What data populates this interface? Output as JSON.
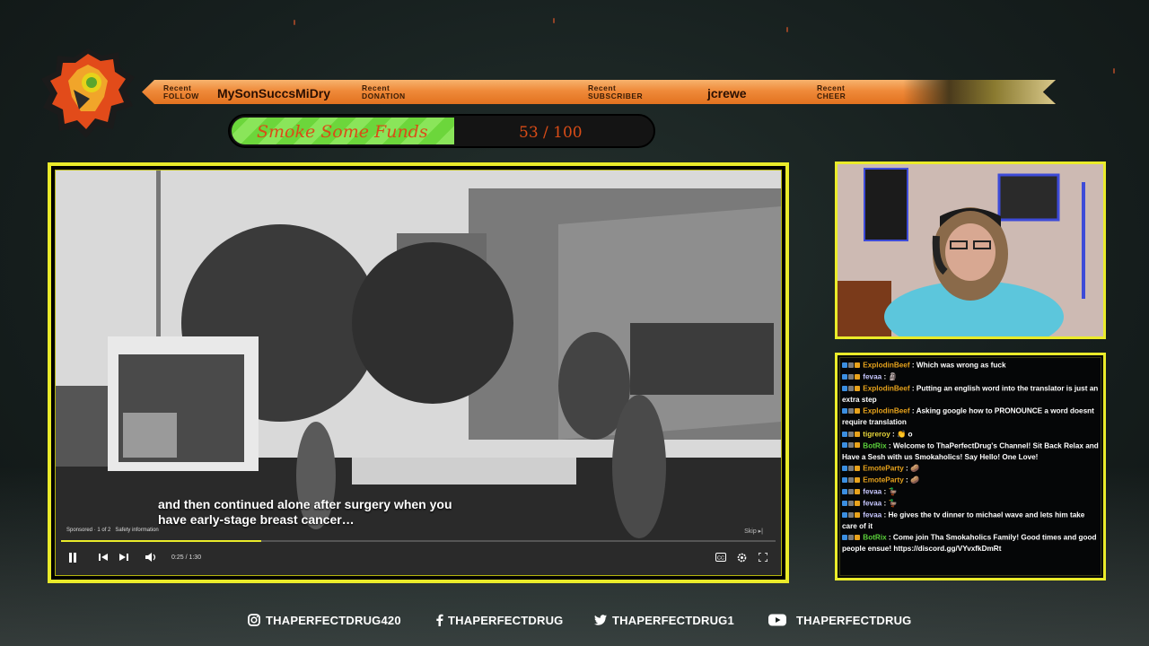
{
  "ticker": {
    "follow": {
      "label_top": "Recent",
      "label_bottom": "FOLLOW",
      "name": "MySonSuccsMiDry"
    },
    "donation": {
      "label_top": "Recent",
      "label_bottom": "DONATION",
      "name": ""
    },
    "subscriber": {
      "label_top": "Recent",
      "label_bottom": "SUBSCRIBER",
      "name": "jcrewe"
    },
    "cheer": {
      "label_top": "Recent",
      "label_bottom": "CHEER",
      "name": ""
    }
  },
  "goal": {
    "title": "Smoke Some Funds",
    "count_text": "53 / 100",
    "current": 53,
    "target": 100
  },
  "video": {
    "subtitle_line1": "and then continued alone after surgery when you",
    "subtitle_line2": "have early-stage breast cancer…",
    "sponsored_label": "Sponsored",
    "ad_counter": "1 of 2",
    "safety_info": "Safety information",
    "skip_label": "Skip",
    "time": "0:25 / 1:30",
    "progress_fraction": 0.28
  },
  "chat": {
    "messages": [
      {
        "user": "ExplodinBeef",
        "user_color": "#e6a21c",
        "text": ": Which was wrong as fuck"
      },
      {
        "user": "fevaa",
        "user_color": "#c7c7ff",
        "text": ": 🗿"
      },
      {
        "user": "ExplodinBeef",
        "user_color": "#e6a21c",
        "text": ": Putting an english word into the translator is just an extra step"
      },
      {
        "user": "ExplodinBeef",
        "user_color": "#e6a21c",
        "text": ": Asking google how to PRONOUNCE a word doesnt require translation"
      },
      {
        "user": "tigreroy",
        "user_color": "#e8d63a",
        "text": ": 👏 o"
      },
      {
        "user": "BotRix",
        "user_color": "#5bd13b",
        "text": ": Welcome to ThaPerfectDrug's Channel! Sit Back Relax and Have a Sesh with us Smokaholics! Say Hello! One Love!"
      },
      {
        "user": "EmoteParty",
        "user_color": "#e6a21c",
        "text": ": 🥔"
      },
      {
        "user": "EmoteParty",
        "user_color": "#e6a21c",
        "text": ": 🥔"
      },
      {
        "user": "fevaa",
        "user_color": "#c7c7ff",
        "text": ": 🦆"
      },
      {
        "user": "fevaa",
        "user_color": "#c7c7ff",
        "text": ": 🦆"
      },
      {
        "user": "fevaa",
        "user_color": "#c7c7ff",
        "text": ": He gives the tv dinner to michael wave and lets him take care of it"
      },
      {
        "user": "BotRix",
        "user_color": "#5bd13b",
        "text": ": Come join Tha Smokaholics Family! Good times and good people ensue! https://discord.gg/VYvxfkDmRt"
      }
    ]
  },
  "socials": {
    "instagram": "THAPERFECTDRUG420",
    "facebook": "THAPERFECTDRUG",
    "twitter": "THAPERFECTDRUG1",
    "youtube": "THAPERFECTDRUG"
  },
  "colors": {
    "accent_yellow": "#eaeb2a",
    "ticker_orange": "#ef8a3a",
    "goal_green": "#6cd63b",
    "goal_text": "#d94c17"
  },
  "icons": [
    "lion-logo-icon",
    "pause-icon",
    "previous-icon",
    "next-icon",
    "volume-icon",
    "captions-icon",
    "settings-icon",
    "fullscreen-icon",
    "instagram-icon",
    "facebook-icon",
    "twitter-icon",
    "youtube-icon"
  ]
}
